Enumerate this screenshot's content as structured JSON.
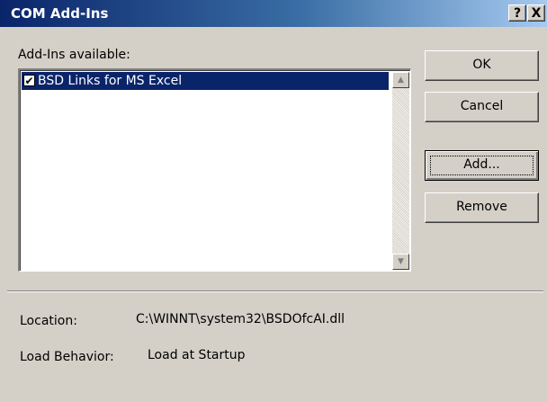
{
  "window": {
    "title": "COM Add-Ins",
    "help_glyph": "?",
    "close_glyph": "X"
  },
  "addins": {
    "label": "Add-Ins available:",
    "items": [
      {
        "label": "BSD Links for MS Excel",
        "checked": true,
        "selected": true
      }
    ],
    "scroll_up_glyph": "▲",
    "scroll_down_glyph": "▼"
  },
  "buttons": {
    "ok": "OK",
    "cancel": "Cancel",
    "add": "Add...",
    "remove": "Remove"
  },
  "details": {
    "location_label": "Location:",
    "location_value": "C:\\WINNT\\system32\\BSDOfcAI.dll",
    "load_behavior_label": "Load Behavior:",
    "load_behavior_value": "Load at Startup"
  },
  "icons": {
    "checkbox": "checkbox-checked-icon",
    "help": "help-icon",
    "close": "close-icon"
  }
}
